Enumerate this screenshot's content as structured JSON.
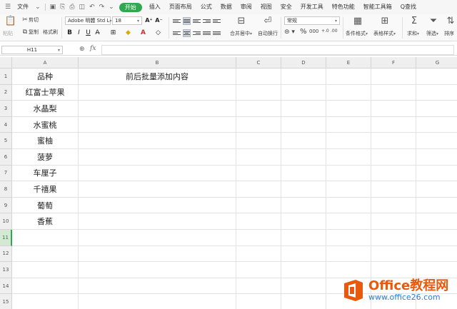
{
  "menubar": {
    "file_label": "文件",
    "tabs": [
      "开始",
      "插入",
      "页面布局",
      "公式",
      "数据",
      "审阅",
      "视图",
      "安全",
      "开发工具",
      "特色功能",
      "智能工具箱"
    ],
    "active_tab": "开始",
    "search_label": "Q查找"
  },
  "ribbon": {
    "cut": "剪切",
    "paste": "粘贴",
    "copy": "复制",
    "format_painter": "格式刷",
    "font_name": "Adobe 明體 Std L",
    "font_size": "18",
    "merge_center": "合并居中",
    "wrap_text": "自动换行",
    "number_format": "常规",
    "conditional_format": "条件格式",
    "table_style": "表格样式",
    "sum": "求和",
    "filter": "筛选",
    "sort": "排序"
  },
  "formula_bar": {
    "name_box": "H11",
    "fx": "fx",
    "value": ""
  },
  "sheet": {
    "columns": [
      "A",
      "B",
      "C",
      "D",
      "E",
      "F",
      "G"
    ],
    "rows": [
      "1",
      "2",
      "3",
      "4",
      "5",
      "6",
      "7",
      "8",
      "9",
      "10",
      "11",
      "12",
      "13",
      "14",
      "15"
    ],
    "selected_row": "11",
    "cells_a": [
      "品种",
      "红富士苹果",
      "水晶梨",
      "水蜜桃",
      "蜜柚",
      "菠萝",
      "车厘子",
      "千禧果",
      "葡萄",
      "香蕉"
    ],
    "cells_b": [
      "前后批量添加内容"
    ]
  },
  "watermark": {
    "title": "Office教程网",
    "url": "www.office26.com",
    "logo_color": "#e8590c"
  }
}
